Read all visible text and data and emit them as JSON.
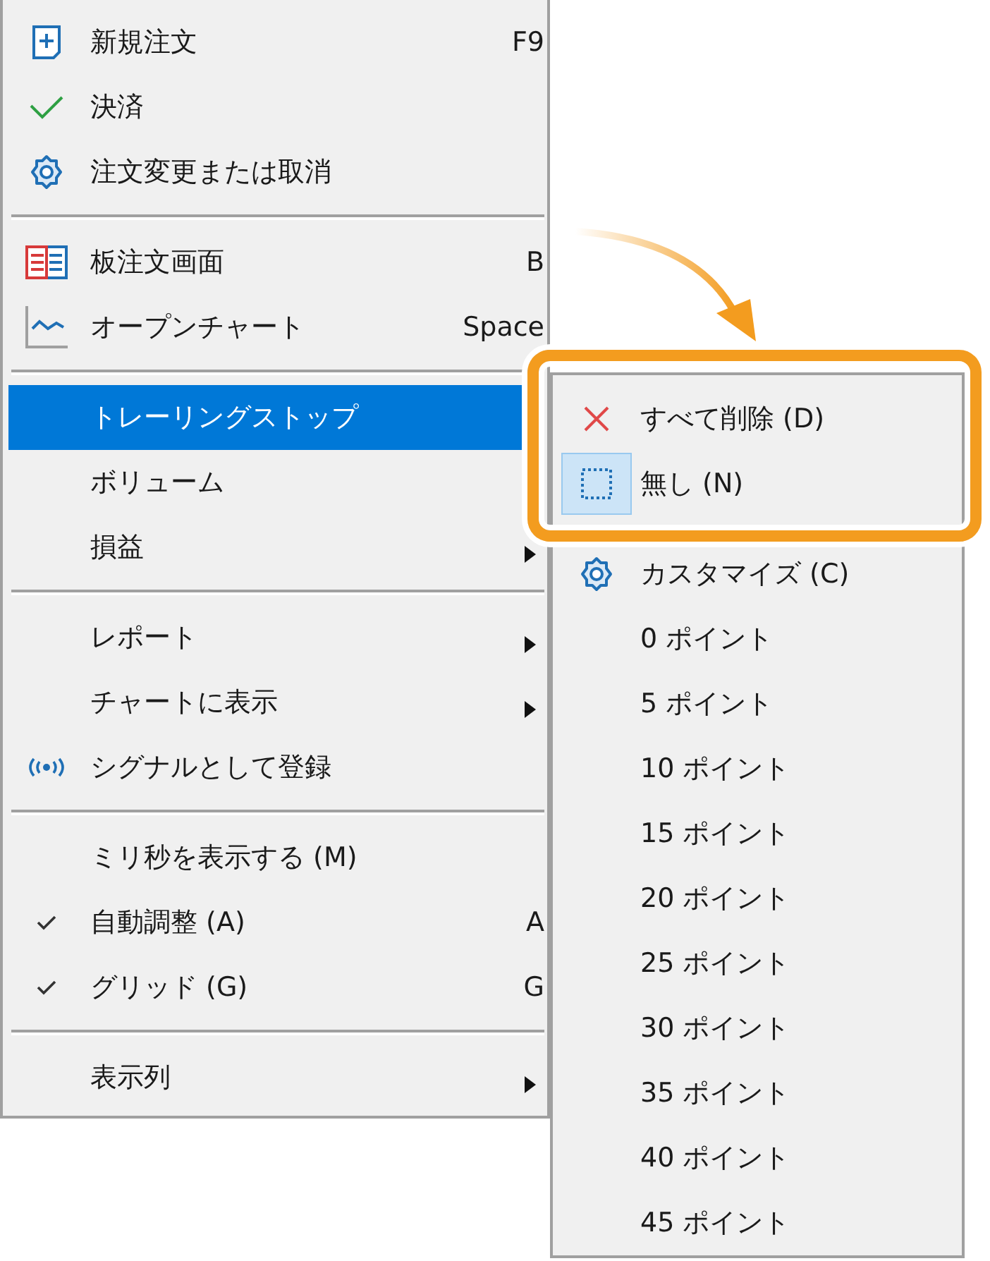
{
  "main_menu": {
    "items": [
      {
        "kind": "item",
        "label": "新規注文",
        "shortcut": "F9",
        "submenu": false,
        "checked": false,
        "selected": false
      },
      {
        "kind": "item",
        "label": "決済",
        "submenu": false,
        "checked": false,
        "selected": false
      },
      {
        "kind": "item",
        "label": "注文変更または取消",
        "submenu": false,
        "checked": false,
        "selected": false
      },
      {
        "kind": "separator"
      },
      {
        "kind": "item",
        "label": "板注文画面",
        "shortcut": "B",
        "submenu": false,
        "checked": false,
        "selected": false
      },
      {
        "kind": "item",
        "label": "オープンチャート",
        "shortcut": "Space",
        "submenu": false,
        "checked": false,
        "selected": false
      },
      {
        "kind": "separator"
      },
      {
        "kind": "item",
        "label": "トレーリングストップ",
        "checked": false,
        "selected": true
      },
      {
        "kind": "item",
        "label": "ボリューム",
        "checked": false,
        "selected": false
      },
      {
        "kind": "item",
        "label": "損益",
        "submenu": true,
        "checked": false,
        "selected": false
      },
      {
        "kind": "separator"
      },
      {
        "kind": "item",
        "label": "レポート",
        "submenu": true,
        "checked": false,
        "selected": false
      },
      {
        "kind": "item",
        "label": "チャートに表示",
        "submenu": true,
        "checked": false,
        "selected": false
      },
      {
        "kind": "item",
        "label": "シグナルとして登録",
        "submenu": false,
        "checked": false,
        "selected": false
      },
      {
        "kind": "separator"
      },
      {
        "kind": "item",
        "label": "ミリ秒を表示する (M)",
        "submenu": false,
        "checked": false,
        "selected": false
      },
      {
        "kind": "item",
        "label": "自動調整 (A)",
        "shortcut": "A",
        "submenu": false,
        "checked": true,
        "selected": false
      },
      {
        "kind": "item",
        "label": "グリッド (G)",
        "shortcut": "G",
        "submenu": false,
        "checked": true,
        "selected": false
      },
      {
        "kind": "separator"
      },
      {
        "kind": "item",
        "label": "表示列",
        "submenu": true,
        "checked": false,
        "selected": false
      }
    ]
  },
  "submenu": {
    "items": [
      {
        "kind": "item",
        "label": "すべて削除 (D)",
        "checked": false
      },
      {
        "kind": "item",
        "label": "無し (N)",
        "checked": true
      },
      {
        "kind": "separator"
      },
      {
        "kind": "item",
        "label": "カスタマイズ (C)",
        "checked": false
      },
      {
        "kind": "item",
        "label": "0 ポイント",
        "checked": false
      },
      {
        "kind": "item",
        "label": "5 ポイント",
        "checked": false
      },
      {
        "kind": "item",
        "label": "10 ポイント",
        "checked": false
      },
      {
        "kind": "item",
        "label": "15 ポイント",
        "checked": false
      },
      {
        "kind": "item",
        "label": "20 ポイント",
        "checked": false
      },
      {
        "kind": "item",
        "label": "25 ポイント",
        "checked": false
      },
      {
        "kind": "item",
        "label": "30 ポイント",
        "checked": false
      },
      {
        "kind": "item",
        "label": "35 ポイント",
        "checked": false
      },
      {
        "kind": "item",
        "label": "40 ポイント",
        "checked": false
      },
      {
        "kind": "item",
        "label": "45 ポイント",
        "checked": false
      }
    ]
  }
}
